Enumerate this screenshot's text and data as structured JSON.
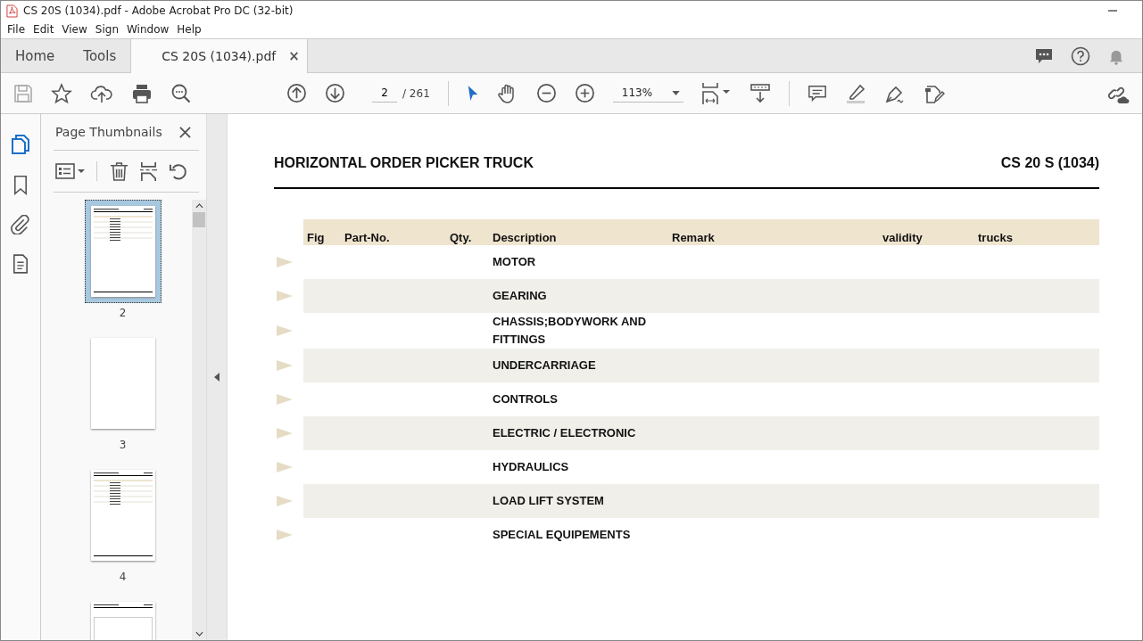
{
  "window": {
    "title": "CS 20S (1034).pdf - Adobe Acrobat Pro DC (32-bit)"
  },
  "menu": [
    "File",
    "Edit",
    "View",
    "Sign",
    "Window",
    "Help"
  ],
  "tabs": [
    {
      "label": "Home",
      "selected": false,
      "closable": false
    },
    {
      "label": "Tools",
      "selected": false,
      "closable": false
    },
    {
      "label": "CS 20S (1034).pdf",
      "selected": true,
      "closable": true
    }
  ],
  "close_glyph": "×",
  "toolbar": {
    "page_current": "2",
    "page_total": "/ 261",
    "zoom": "113%"
  },
  "side_panel": {
    "title": "Page Thumbnails",
    "thumbnails": [
      {
        "page": "2",
        "selected": true,
        "kind": "toc"
      },
      {
        "page": "3",
        "selected": false,
        "kind": "blank"
      },
      {
        "page": "4",
        "selected": false,
        "kind": "toc"
      },
      {
        "kind": "figure",
        "selected": false
      }
    ]
  },
  "document": {
    "title": "HORIZONTAL ORDER PICKER TRUCK",
    "model": "CS 20 S (1034)",
    "columns": [
      "Fig",
      "Part-No.",
      "Qty.",
      "Description",
      "Remark",
      "validity",
      "trucks"
    ],
    "rows": [
      {
        "description": "MOTOR"
      },
      {
        "description": "GEARING"
      },
      {
        "description": "CHASSIS;BODYWORK AND FITTINGS"
      },
      {
        "description": "UNDERCARRIAGE"
      },
      {
        "description": "CONTROLS"
      },
      {
        "description": "ELECTRIC / ELECTRONIC"
      },
      {
        "description": "HYDRAULICS"
      },
      {
        "description": "LOAD LIFT SYSTEM"
      },
      {
        "description": "SPECIAL EQUIPEMENTS"
      }
    ]
  }
}
